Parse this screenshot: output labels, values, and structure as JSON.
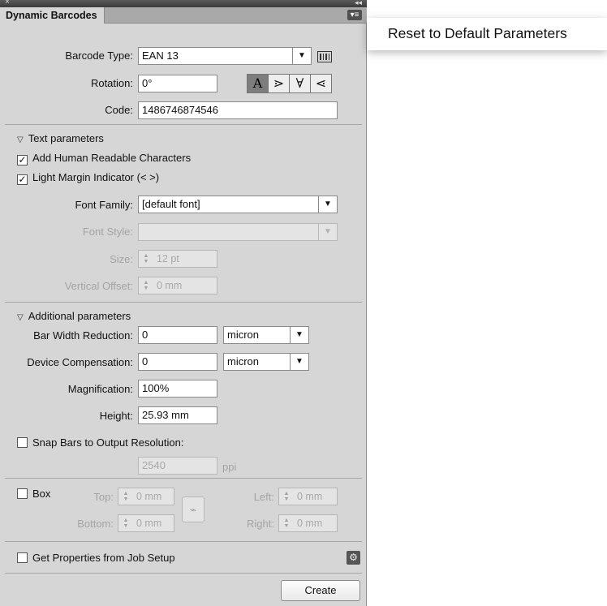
{
  "panel": {
    "tab_title": "Dynamic Barcodes",
    "close_glyph": "×",
    "collapse_glyph": "◂◂",
    "menu_glyph": "▾≡"
  },
  "barcode": {
    "type_label": "Barcode Type:",
    "type_value": "EAN 13",
    "rotation_label": "Rotation:",
    "rotation_value": "0°",
    "rotation_buttons": [
      "A",
      "⋗",
      "∀",
      "⋖"
    ],
    "code_label": "Code:",
    "code_value": "1486746874546"
  },
  "text_params": {
    "header": "Text parameters",
    "human_readable": "Add Human Readable Characters",
    "light_margin": "Light Margin Indicator (< >)",
    "font_family_label": "Font Family:",
    "font_family_value": "[default font]",
    "font_style_label": "Font Style:",
    "size_label": "Size:",
    "size_value": "12 pt",
    "voffset_label": "Vertical Offset:",
    "voffset_value": "0 mm"
  },
  "additional": {
    "header": "Additional parameters",
    "bwr_label": "Bar Width Reduction:",
    "bwr_value": "0",
    "bwr_unit": "micron",
    "dc_label": "Device Compensation:",
    "dc_value": "0",
    "dc_unit": "micron",
    "mag_label": "Magnification:",
    "mag_value": "100%",
    "height_label": "Height:",
    "height_value": "25.93 mm",
    "snap_label": "Snap Bars to Output Resolution:",
    "snap_value": "2540",
    "snap_unit": "ppi"
  },
  "box": {
    "label": "Box",
    "top_label": "Top:",
    "top_value": "0 mm",
    "bottom_label": "Bottom:",
    "bottom_value": "0 mm",
    "left_label": "Left:",
    "left_value": "0 mm",
    "right_label": "Right:",
    "right_value": "0 mm"
  },
  "job_setup": {
    "label": "Get Properties from Job Setup"
  },
  "create_button": "Create",
  "popup_menu": {
    "item": "Reset to Default Parameters"
  },
  "icons": {
    "checkmark": "✓",
    "dd_arrow": "▼",
    "spin_up": "▲",
    "spin_down": "▼",
    "link": "⌁",
    "gear": "⚙",
    "triangle": "▽"
  }
}
